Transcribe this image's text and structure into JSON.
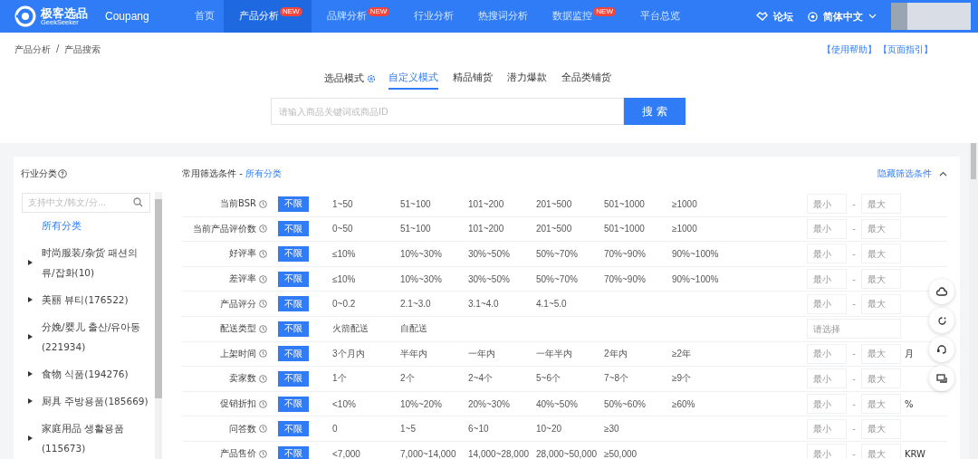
{
  "header": {
    "logo_title": "极客选品",
    "logo_subtitle": "GeekSeeker",
    "platform": "Coupang",
    "nav": [
      {
        "label": "首页",
        "selected": false
      },
      {
        "label": "产品分析",
        "selected": true,
        "badge": "NEW"
      },
      {
        "label": "品牌分析",
        "selected": false,
        "badge": "NEW"
      },
      {
        "label": "行业分析",
        "selected": false
      },
      {
        "label": "热搜词分析",
        "selected": false
      },
      {
        "label": "数据监控",
        "selected": false,
        "badge": "NEW"
      },
      {
        "label": "平台总览",
        "selected": false
      }
    ],
    "forum": "论坛",
    "language": "简体中文"
  },
  "breadcrumb": [
    "产品分析",
    "产品搜索"
  ],
  "breadcrumb_separator": "/",
  "help_links": [
    "【使用帮助】",
    "【页面指引】"
  ],
  "mode_label": "选品模式",
  "mode_tabs": [
    {
      "label": "自定义模式",
      "selected": true
    },
    {
      "label": "精品铺货",
      "selected": false
    },
    {
      "label": "潜力爆款",
      "selected": false
    },
    {
      "label": "全品类铺货",
      "selected": false
    }
  ],
  "search": {
    "placeholder": "请输入商品关键词或商品ID",
    "button": "搜 索"
  },
  "category_panel": {
    "title": "行业分类",
    "search_placeholder": "支持中文/韩文/分...",
    "items": [
      {
        "label": "所有分类",
        "selected": true,
        "expandable": false
      },
      {
        "label": "时尚服装/杂货 패션의류/잡화(10)",
        "selected": false,
        "expandable": true
      },
      {
        "label": "美丽 뷰티(176522)",
        "selected": false,
        "expandable": true
      },
      {
        "label": "分娩/婴儿 출산/유아동(221934)",
        "selected": false,
        "expandable": true
      },
      {
        "label": "食物 식품(194276)",
        "selected": false,
        "expandable": true
      },
      {
        "label": "厨具 주방용품(185669)",
        "selected": false,
        "expandable": true
      },
      {
        "label": "家庭用品 생활용품(115673)",
        "selected": false,
        "expandable": true
      }
    ]
  },
  "filters": {
    "title": "常用筛选条件 - ",
    "category": "所有分类",
    "toggle": "隐藏筛选条件",
    "rows": [
      {
        "label": "当前BSR",
        "any": "不限",
        "any_selected": true,
        "options": [
          "1~50",
          "51~100",
          "101~200",
          "201~500",
          "501~1000",
          "≥1000"
        ],
        "kind": "range",
        "min_placeholder": "最小",
        "separator": "-",
        "max_placeholder": "最大"
      },
      {
        "label": "当前产品评价数",
        "any": "不限",
        "any_selected": true,
        "options": [
          "0~50",
          "51~100",
          "101~200",
          "201~500",
          "501~1000",
          "≥1000"
        ],
        "kind": "range",
        "min_placeholder": "最小",
        "separator": "-",
        "max_placeholder": "最大"
      },
      {
        "label": "好评率",
        "any": "不限",
        "any_selected": true,
        "options": [
          "≤10%",
          "10%~30%",
          "30%~50%",
          "50%~70%",
          "70%~90%",
          "90%~100%"
        ],
        "kind": "range",
        "min_placeholder": "最小",
        "separator": "-",
        "max_placeholder": "最大"
      },
      {
        "label": "差评率",
        "any": "不限",
        "any_selected": true,
        "options": [
          "≤10%",
          "10%~30%",
          "30%~50%",
          "50%~70%",
          "70%~90%",
          "90%~100%"
        ],
        "kind": "range",
        "min_placeholder": "最小",
        "separator": "-",
        "max_placeholder": "最大"
      },
      {
        "label": "产品评分",
        "any": "不限",
        "any_selected": true,
        "options": [
          "0~0.2",
          "2.1~3.0",
          "3.1~4.0",
          "4.1~5.0"
        ],
        "kind": "range",
        "min_placeholder": "最小",
        "separator": "-",
        "max_placeholder": "最大"
      },
      {
        "label": "配送类型",
        "any": "不限",
        "any_selected": true,
        "options": [
          "火箭配送",
          "自配送"
        ],
        "kind": "select",
        "placeholder": "请选择"
      },
      {
        "label": "上架时间",
        "any": "不限",
        "any_selected": true,
        "options": [
          "3个月内",
          "半年内",
          "一年内",
          "一年半内",
          "2年内",
          "≥2年"
        ],
        "kind": "range",
        "min_placeholder": "最小",
        "separator": "-",
        "max_placeholder": "最大",
        "unit": "月"
      },
      {
        "label": "卖家数",
        "any": "不限",
        "any_selected": true,
        "options": [
          "1个",
          "2个",
          "2~4个",
          "5~6个",
          "7~8个",
          "≥9个"
        ],
        "kind": "range",
        "min_placeholder": "最小",
        "separator": "-",
        "max_placeholder": "最大"
      },
      {
        "label": "促销折扣",
        "any": "不限",
        "any_selected": true,
        "options": [
          "<10%",
          "10%~20%",
          "20%~30%",
          "40%~50%",
          "50%~60%",
          "≥60%"
        ],
        "kind": "range",
        "min_placeholder": "最小",
        "separator": "-",
        "max_placeholder": "最大",
        "unit": "%"
      },
      {
        "label": "问答数",
        "any": "不限",
        "any_selected": true,
        "options": [
          "0",
          "1~5",
          "6~10",
          "10~20",
          "≥30"
        ],
        "kind": "range",
        "min_placeholder": "最小",
        "separator": "-",
        "max_placeholder": "最大"
      },
      {
        "label": "产品售价",
        "any": "不限",
        "any_selected": true,
        "options": [
          "<7,000",
          "7,000~14,000",
          "14,000~28,000",
          "28,000~50,000",
          "≥50,000"
        ],
        "kind": "range",
        "min_placeholder": "最小",
        "separator": "-",
        "max_placeholder": "最大",
        "unit": "KRW"
      }
    ]
  }
}
